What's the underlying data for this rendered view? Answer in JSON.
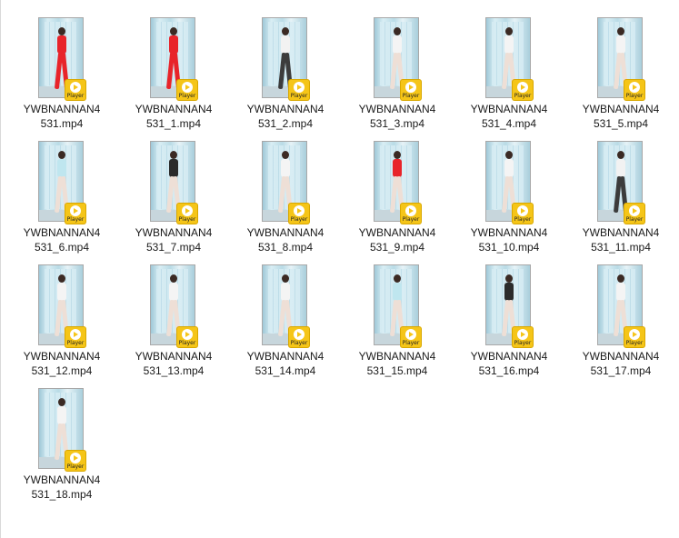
{
  "files": [
    {
      "name": "YWBNANNAN4531.mp4",
      "line1": "YWBNANNAN4",
      "line2": "531.mp4",
      "outfit": "#e8242a",
      "legs": "#e8242a"
    },
    {
      "name": "YWBNANNAN4531_1.mp4",
      "line1": "YWBNANNAN4",
      "line2": "531_1.mp4",
      "outfit": "#e8242a",
      "legs": "#e8242a"
    },
    {
      "name": "YWBNANNAN4531_2.mp4",
      "line1": "YWBNANNAN4",
      "line2": "531_2.mp4",
      "outfit": "#f2f2f2",
      "legs": "#3c3c3c"
    },
    {
      "name": "YWBNANNAN4531_3.mp4",
      "line1": "YWBNANNAN4",
      "line2": "531_3.mp4",
      "outfit": "#f4f4f4",
      "legs": "#eedfd6"
    },
    {
      "name": "YWBNANNAN4531_4.mp4",
      "line1": "YWBNANNAN4",
      "line2": "531_4.mp4",
      "outfit": "#f4f4f4",
      "legs": "#eedfd6"
    },
    {
      "name": "YWBNANNAN4531_5.mp4",
      "line1": "YWBNANNAN4",
      "line2": "531_5.mp4",
      "outfit": "#f4f4f4",
      "legs": "#eedfd6"
    },
    {
      "name": "YWBNANNAN4531_6.mp4",
      "line1": "YWBNANNAN4",
      "line2": "531_6.mp4",
      "outfit": "#bfe6ef",
      "legs": "#eedfd6"
    },
    {
      "name": "YWBNANNAN4531_7.mp4",
      "line1": "YWBNANNAN4",
      "line2": "531_7.mp4",
      "outfit": "#2b2b2b",
      "legs": "#eedfd6"
    },
    {
      "name": "YWBNANNAN4531_8.mp4",
      "line1": "YWBNANNAN4",
      "line2": "531_8.mp4",
      "outfit": "#f4f4f4",
      "legs": "#eedfd6"
    },
    {
      "name": "YWBNANNAN4531_9.mp4",
      "line1": "YWBNANNAN4",
      "line2": "531_9.mp4",
      "outfit": "#e8242a",
      "legs": "#eedfd6"
    },
    {
      "name": "YWBNANNAN4531_10.mp4",
      "line1": "YWBNANNAN4",
      "line2": "531_10.mp4",
      "outfit": "#f4f4f4",
      "legs": "#eedfd6"
    },
    {
      "name": "YWBNANNAN4531_11.mp4",
      "line1": "YWBNANNAN4",
      "line2": "531_11.mp4",
      "outfit": "#f2f2f2",
      "legs": "#3c3c3c"
    },
    {
      "name": "YWBNANNAN4531_12.mp4",
      "line1": "YWBNANNAN4",
      "line2": "531_12.mp4",
      "outfit": "#f4f4f4",
      "legs": "#eedfd6"
    },
    {
      "name": "YWBNANNAN4531_13.mp4",
      "line1": "YWBNANNAN4",
      "line2": "531_13.mp4",
      "outfit": "#f4f4f4",
      "legs": "#eedfd6"
    },
    {
      "name": "YWBNANNAN4531_14.mp4",
      "line1": "YWBNANNAN4",
      "line2": "531_14.mp4",
      "outfit": "#f4f4f4",
      "legs": "#eedfd6"
    },
    {
      "name": "YWBNANNAN4531_15.mp4",
      "line1": "YWBNANNAN4",
      "line2": "531_15.mp4",
      "outfit": "#bfe6ef",
      "legs": "#eedfd6"
    },
    {
      "name": "YWBNANNAN4531_16.mp4",
      "line1": "YWBNANNAN4",
      "line2": "531_16.mp4",
      "outfit": "#2b2b2b",
      "legs": "#eedfd6"
    },
    {
      "name": "YWBNANNAN4531_17.mp4",
      "line1": "YWBNANNAN4",
      "line2": "531_17.mp4",
      "outfit": "#f4f4f4",
      "legs": "#eedfd6"
    },
    {
      "name": "YWBNANNAN4531_18.mp4",
      "line1": "YWBNANNAN4",
      "line2": "531_18.mp4",
      "outfit": "#f4f4f4",
      "legs": "#eedfd6"
    }
  ],
  "badge_label": "Player",
  "badge_icon": "play-icon"
}
